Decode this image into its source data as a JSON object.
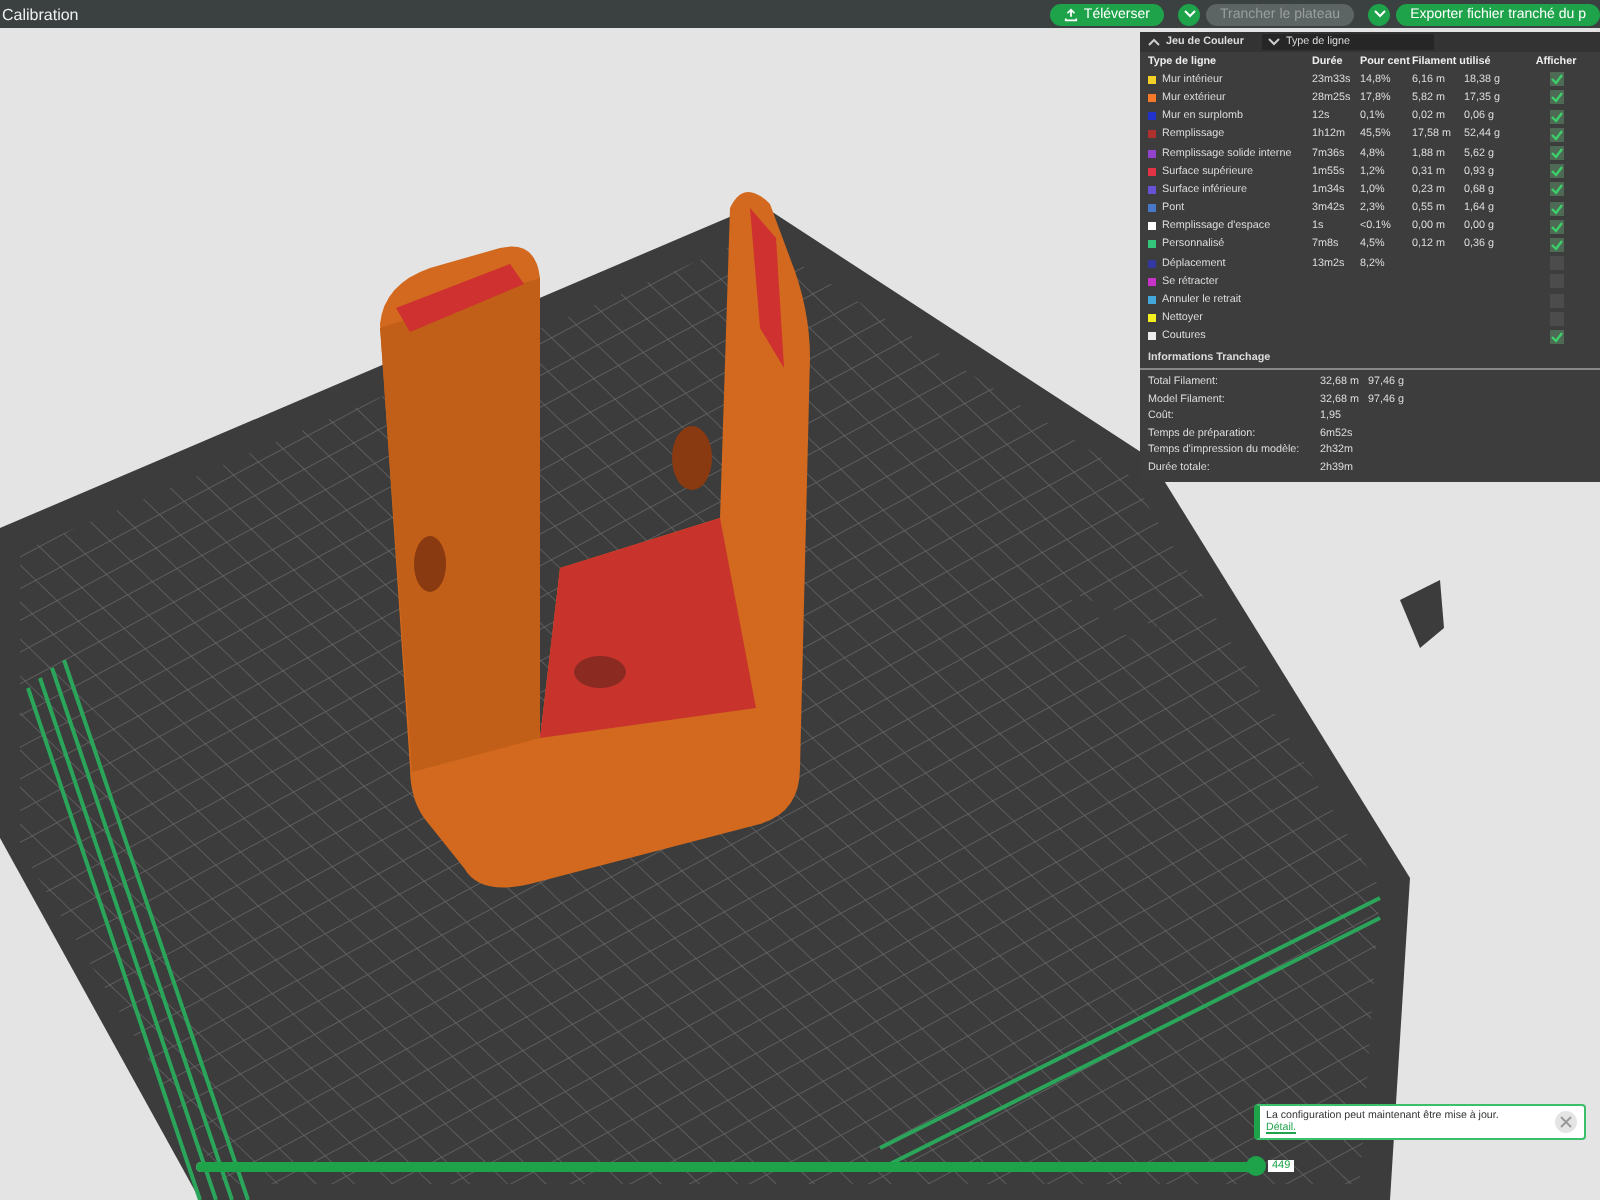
{
  "window": {
    "title": "Calibration"
  },
  "toolbar": {
    "buttons": [
      {
        "label": "Téléverser",
        "kind": "upload",
        "disabled": false
      },
      {
        "label": "Trancher le plateau",
        "kind": "dropdown",
        "disabled": true
      },
      {
        "label": "Exporter fichier tranché du p",
        "kind": "dropdown",
        "disabled": false
      }
    ]
  },
  "legend": {
    "title": "Jeu de Couleur",
    "dropdown": "Type de ligne",
    "columns": [
      "Type de ligne",
      "Durée",
      "Pour cent",
      "Filament utilisé",
      "Afficher"
    ],
    "rows": [
      {
        "name": "Mur intérieur",
        "color": "#f2d028",
        "duration": "23m33s",
        "percent": "14,8%",
        "length": "6,16 m",
        "weight": "18,38 g",
        "shown": true
      },
      {
        "name": "Mur extérieur",
        "color": "#f47a2a",
        "duration": "28m25s",
        "percent": "17,8%",
        "length": "5,82 m",
        "weight": "17,35 g",
        "shown": true
      },
      {
        "name": "Mur en surplomb",
        "color": "#2233cc",
        "duration": "12s",
        "percent": "0,1%",
        "length": "0,02 m",
        "weight": "0,06 g",
        "shown": true
      },
      {
        "name": "Remplissage",
        "color": "#b03030",
        "duration": "1h12m",
        "percent": "45,5%",
        "length": "17,58 m",
        "weight": "52,44 g",
        "shown": true
      },
      {
        "name": "Remplissage solide interne",
        "color": "#9444cc",
        "duration": "7m36s",
        "percent": "4,8%",
        "length": "1,88 m",
        "weight": "5,62 g",
        "shown": true
      },
      {
        "name": "Surface supérieure",
        "color": "#e23444",
        "duration": "1m55s",
        "percent": "1,2%",
        "length": "0,31 m",
        "weight": "0,93 g",
        "shown": true
      },
      {
        "name": "Surface inférieure",
        "color": "#6a52d6",
        "duration": "1m34s",
        "percent": "1,0%",
        "length": "0,23 m",
        "weight": "0,68 g",
        "shown": true
      },
      {
        "name": "Pont",
        "color": "#4a78c8",
        "duration": "3m42s",
        "percent": "2,3%",
        "length": "0,55 m",
        "weight": "1,64 g",
        "shown": true
      },
      {
        "name": "Remplissage d'espace",
        "color": "#ffffff",
        "duration": "1s",
        "percent": "<0.1%",
        "length": "0,00 m",
        "weight": "0,00 g",
        "shown": true
      },
      {
        "name": "Personnalisé",
        "color": "#34c47a",
        "duration": "7m8s",
        "percent": "4,5%",
        "length": "0,12 m",
        "weight": "0,36 g",
        "shown": true
      },
      {
        "name": "Déplacement",
        "color": "#3438a0",
        "duration": "13m2s",
        "percent": "8,2%",
        "shown": false
      },
      {
        "name": "Se rétracter",
        "color": "#c834c8",
        "shown": false
      },
      {
        "name": "Annuler le retrait",
        "color": "#44a8d8",
        "shown": false
      },
      {
        "name": "Nettoyer",
        "color": "#f4f020",
        "shown": false
      },
      {
        "name": "Coutures",
        "color": "#eeeeee",
        "shown": true
      }
    ],
    "info_title": "Informations Tranchage",
    "info": [
      {
        "label": "Total Filament:",
        "value": "32,68 m",
        "value_2": "97,46 g"
      },
      {
        "label": "Model Filament:",
        "value": "32,68 m",
        "value_2": "97,46 g"
      },
      {
        "label": "Coût:",
        "value": "1,95"
      },
      {
        "label": "Temps de préparation:",
        "value": "6m52s"
      },
      {
        "label": "Temps d'impression du modèle:",
        "value": "2h32m"
      },
      {
        "label": "Durée totale:",
        "value": "2h39m"
      }
    ]
  },
  "notification": {
    "text": "La configuration peut maintenant être mise à jour.",
    "link": "Détail."
  },
  "layer_slider": {
    "level": 1,
    "value": "449"
  }
}
